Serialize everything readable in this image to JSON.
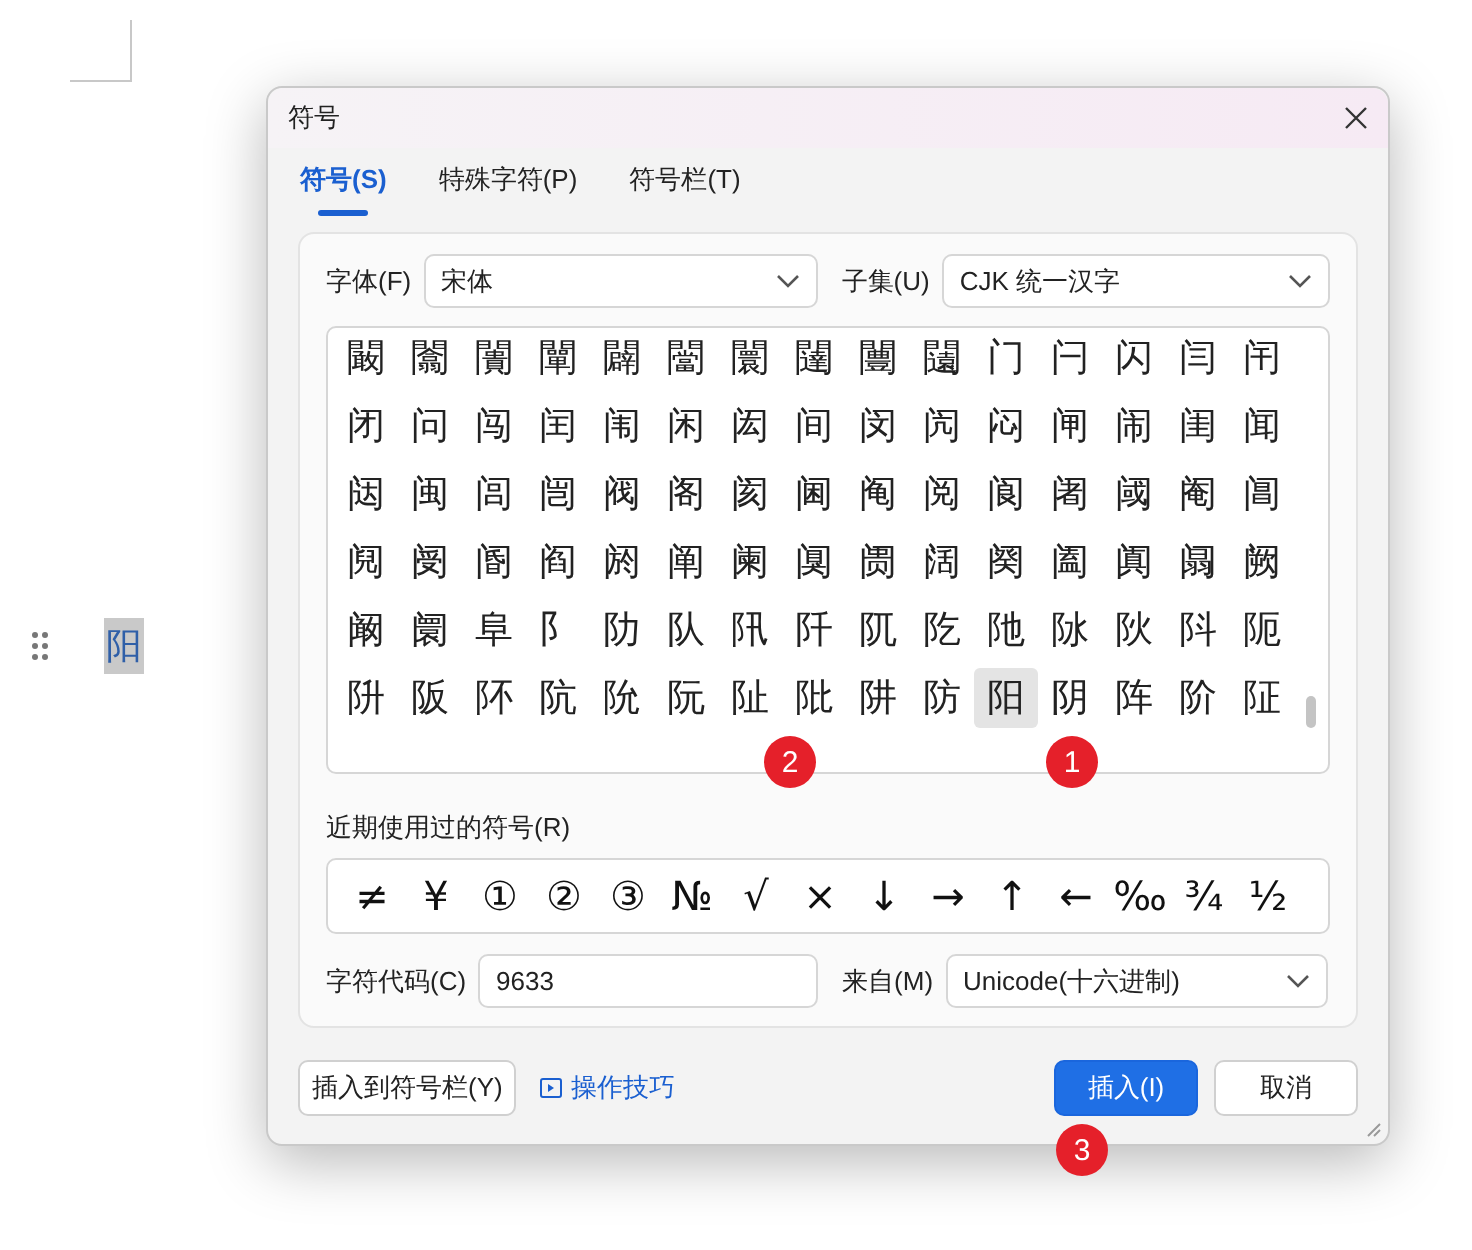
{
  "document": {
    "selected_text": "阳"
  },
  "window": {
    "title": "符号"
  },
  "tabs": [
    {
      "label": "符号(S)",
      "selected": true
    },
    {
      "label": "特殊字符(P)",
      "selected": false
    },
    {
      "label": "符号栏(T)",
      "selected": false
    }
  ],
  "font": {
    "label": "字体(F)",
    "value": "宋体"
  },
  "subset": {
    "label": "子集(U)",
    "value": "CJK 统一汉字"
  },
  "grid": {
    "rows": [
      [
        {
          "char": "闞",
          "selected": false
        },
        {
          "char": "闟",
          "selected": false
        },
        {
          "char": "闠",
          "selected": false
        },
        {
          "char": "闡",
          "selected": false
        },
        {
          "char": "闢",
          "selected": false
        },
        {
          "char": "闣",
          "selected": false
        },
        {
          "char": "闤",
          "selected": false
        },
        {
          "char": "闥",
          "selected": false
        },
        {
          "char": "闦",
          "selected": false
        },
        {
          "char": "闧",
          "selected": false
        },
        {
          "char": "门",
          "selected": false
        },
        {
          "char": "闩",
          "selected": false
        },
        {
          "char": "闪",
          "selected": false
        },
        {
          "char": "闫",
          "selected": false
        },
        {
          "char": "闬",
          "selected": false
        }
      ],
      [
        {
          "char": "闭",
          "selected": false
        },
        {
          "char": "问",
          "selected": false
        },
        {
          "char": "闯",
          "selected": false
        },
        {
          "char": "闰",
          "selected": false
        },
        {
          "char": "闱",
          "selected": false
        },
        {
          "char": "闲",
          "selected": false
        },
        {
          "char": "闳",
          "selected": false
        },
        {
          "char": "间",
          "selected": false
        },
        {
          "char": "闵",
          "selected": false
        },
        {
          "char": "闶",
          "selected": false
        },
        {
          "char": "闷",
          "selected": false
        },
        {
          "char": "闸",
          "selected": false
        },
        {
          "char": "闹",
          "selected": false
        },
        {
          "char": "闺",
          "selected": false
        },
        {
          "char": "闻",
          "selected": false
        }
      ],
      [
        {
          "char": "闼",
          "selected": false
        },
        {
          "char": "闽",
          "selected": false
        },
        {
          "char": "闾",
          "selected": false
        },
        {
          "char": "闿",
          "selected": false
        },
        {
          "char": "阀",
          "selected": false
        },
        {
          "char": "阁",
          "selected": false
        },
        {
          "char": "阂",
          "selected": false
        },
        {
          "char": "阃",
          "selected": false
        },
        {
          "char": "阄",
          "selected": false
        },
        {
          "char": "阅",
          "selected": false
        },
        {
          "char": "阆",
          "selected": false
        },
        {
          "char": "阇",
          "selected": false
        },
        {
          "char": "阈",
          "selected": false
        },
        {
          "char": "阉",
          "selected": false
        },
        {
          "char": "阊",
          "selected": false
        }
      ],
      [
        {
          "char": "阋",
          "selected": false
        },
        {
          "char": "阌",
          "selected": false
        },
        {
          "char": "阍",
          "selected": false
        },
        {
          "char": "阎",
          "selected": false
        },
        {
          "char": "阏",
          "selected": false
        },
        {
          "char": "阐",
          "selected": false
        },
        {
          "char": "阑",
          "selected": false
        },
        {
          "char": "阒",
          "selected": false
        },
        {
          "char": "阓",
          "selected": false
        },
        {
          "char": "阔",
          "selected": false
        },
        {
          "char": "阕",
          "selected": false
        },
        {
          "char": "阖",
          "selected": false
        },
        {
          "char": "阗",
          "selected": false
        },
        {
          "char": "阘",
          "selected": false
        },
        {
          "char": "阙",
          "selected": false
        }
      ],
      [
        {
          "char": "阚",
          "selected": false
        },
        {
          "char": "阛",
          "selected": false
        },
        {
          "char": "阜",
          "selected": false
        },
        {
          "char": "阝",
          "selected": false
        },
        {
          "char": "阞",
          "selected": false
        },
        {
          "char": "队",
          "selected": false
        },
        {
          "char": "阠",
          "selected": false
        },
        {
          "char": "阡",
          "selected": false
        },
        {
          "char": "阢",
          "selected": false
        },
        {
          "char": "阣",
          "selected": false
        },
        {
          "char": "阤",
          "selected": false
        },
        {
          "char": "阥",
          "selected": false
        },
        {
          "char": "阦",
          "selected": false
        },
        {
          "char": "阧",
          "selected": false
        },
        {
          "char": "阨",
          "selected": false
        }
      ],
      [
        {
          "char": "阩",
          "selected": false
        },
        {
          "char": "阪",
          "selected": false
        },
        {
          "char": "阫",
          "selected": false
        },
        {
          "char": "阬",
          "selected": false
        },
        {
          "char": "阭",
          "selected": false
        },
        {
          "char": "阮",
          "selected": false
        },
        {
          "char": "阯",
          "selected": false
        },
        {
          "char": "阰",
          "selected": false
        },
        {
          "char": "阱",
          "selected": false
        },
        {
          "char": "防",
          "selected": false
        },
        {
          "char": "阳",
          "selected": true
        },
        {
          "char": "阴",
          "selected": false
        },
        {
          "char": "阵",
          "selected": false
        },
        {
          "char": "阶",
          "selected": false
        },
        {
          "char": "阷",
          "selected": false
        }
      ]
    ]
  },
  "recent": {
    "label": "近期使用过的符号(R)",
    "symbols": [
      "≠",
      "¥",
      "①",
      "②",
      "③",
      "№",
      "√",
      "×",
      "↓",
      "→",
      "↑",
      "←",
      "‰",
      "¾",
      "½"
    ]
  },
  "char_code": {
    "label": "字符代码(C)",
    "value": "9633"
  },
  "from": {
    "label": "来自(M)",
    "value": "Unicode(十六进制)"
  },
  "buttons": {
    "insert_to_bar": "插入到符号栏(Y)",
    "tips": "操作技巧",
    "insert": "插入(I)",
    "cancel": "取消"
  },
  "callouts": [
    "1",
    "2",
    "3"
  ]
}
